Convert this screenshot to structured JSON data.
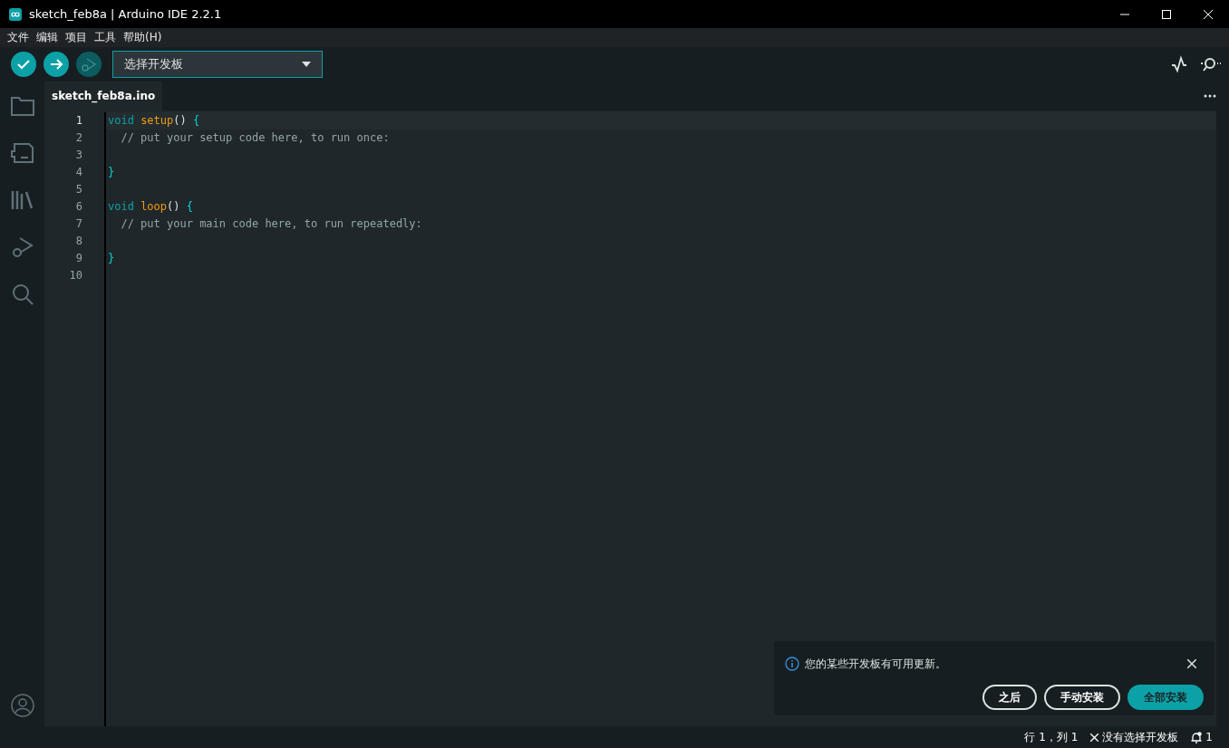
{
  "window": {
    "title": "sketch_feb8a | Arduino IDE 2.2.1"
  },
  "menu": [
    "文件",
    "编辑",
    "项目",
    "工具",
    "帮助(H)"
  ],
  "toolbar": {
    "board_select": "选择开发板",
    "debug_disabled": true
  },
  "tabs": [
    {
      "label": "sketch_feb8a.ino",
      "selected": true
    }
  ],
  "editor": {
    "lines": [
      {
        "number": "1",
        "current": true,
        "tokens": [
          {
            "text": "void ",
            "kind": "keyword"
          },
          {
            "text": "setup",
            "kind": "function"
          },
          {
            "text": "() ",
            "kind": "plain"
          },
          {
            "text": "{",
            "kind": "brace"
          }
        ]
      },
      {
        "number": "2",
        "current": false,
        "tokens": [
          {
            "text": "  // put your setup code here, to run once:",
            "kind": "comment"
          }
        ]
      },
      {
        "number": "3",
        "current": false
      },
      {
        "number": "4",
        "current": false,
        "tokens": [
          {
            "text": "}",
            "kind": "brace"
          }
        ]
      },
      {
        "number": "5",
        "current": false
      },
      {
        "number": "6",
        "current": false,
        "tokens": [
          {
            "text": "void ",
            "kind": "keyword"
          },
          {
            "text": "loop",
            "kind": "function"
          },
          {
            "text": "() ",
            "kind": "plain"
          },
          {
            "text": "{",
            "kind": "brace"
          }
        ]
      },
      {
        "number": "7",
        "current": false,
        "tokens": [
          {
            "text": "  // put your main code here, to run repeatedly:",
            "kind": "comment"
          }
        ]
      },
      {
        "number": "8",
        "current": false
      },
      {
        "number": "9",
        "current": false,
        "tokens": [
          {
            "text": "}",
            "kind": "brace"
          }
        ]
      },
      {
        "number": "10",
        "current": false
      }
    ]
  },
  "notification": {
    "message": "您的某些开发板有可用更新。",
    "buttons": [
      {
        "label": "之后",
        "kind": "outline"
      },
      {
        "label": "手动安装",
        "kind": "outline"
      },
      {
        "label": "全部安装",
        "kind": "primary"
      }
    ]
  },
  "status_bar": {
    "position": "行 1，列 1",
    "board": "没有选择开发板",
    "notifications": "1"
  }
}
